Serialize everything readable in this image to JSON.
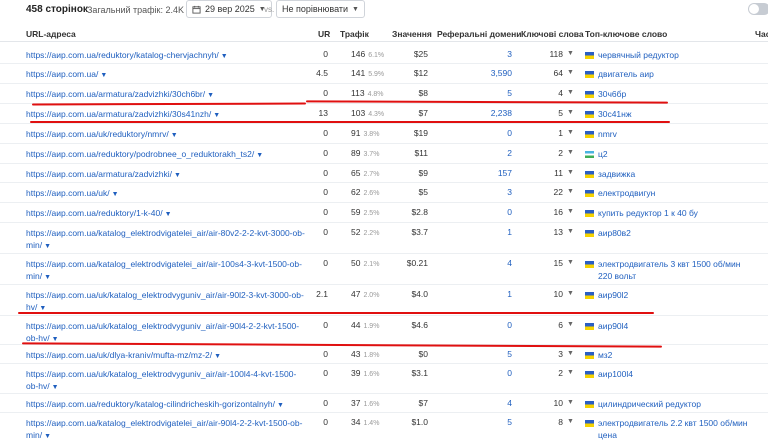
{
  "toolbar": {
    "pages_count": "458 сторінок",
    "total_traffic": "Загальний трафік: 2.4K",
    "date": "29 вер 2025",
    "vs": "vs.",
    "compare": "Не порівнювати"
  },
  "columns": {
    "url": "URL-адреса",
    "ur": "UR",
    "traffic": "Трафік",
    "value": "Значення",
    "ref_domains": "Реферальні домени",
    "keywords": "Ключові слова",
    "top_keyword": "Топ-ключове слово",
    "edge": "Част"
  },
  "rows": [
    {
      "url": "https://аир.com.ua/reduktory/katalog-chervjachnyh/",
      "ur": "0",
      "traffic": "146",
      "pct": "6.1%",
      "value": "$25",
      "ref": "3",
      "kw": "118",
      "flag": "ua",
      "top_kw": "червячный редуктор",
      "edge": ""
    },
    {
      "url": "https://аир.com.ua/",
      "ur": "4.5",
      "traffic": "141",
      "pct": "5.9%",
      "value": "$12",
      "ref": "3,590",
      "kw": "64",
      "flag": "ua",
      "top_kw": "двигатель аир",
      "edge": ""
    },
    {
      "url": "https://аир.com.ua/armatura/zadvizhki/30ch6br/",
      "ur": "0",
      "traffic": "113",
      "pct": "4.8%",
      "value": "$8",
      "ref": "5",
      "kw": "4",
      "flag": "ua",
      "top_kw": "30ч6бр",
      "edge": ""
    },
    {
      "url": "https://аир.com.ua/armatura/zadvizhki/30s41nzh/",
      "ur": "13",
      "traffic": "103",
      "pct": "4.3%",
      "value": "$7",
      "ref": "2,238",
      "kw": "5",
      "flag": "ua",
      "top_kw": "30с41нж",
      "edge": ""
    },
    {
      "url": "https://аир.com.ua/uk/reduktory/nmrv/",
      "ur": "0",
      "traffic": "91",
      "pct": "3.8%",
      "value": "$19",
      "ref": "0",
      "kw": "1",
      "flag": "ua",
      "top_kw": "nmrv",
      "edge": ""
    },
    {
      "url": "https://аир.com.ua/reduktory/podrobnee_o_reduktorakh_ts2/",
      "ur": "0",
      "traffic": "89",
      "pct": "3.7%",
      "value": "$11",
      "ref": "2",
      "kw": "2",
      "flag": "uz",
      "top_kw": "ц2",
      "edge": ""
    },
    {
      "url": "https://аир.com.ua/armatura/zadvizhki/",
      "ur": "0",
      "traffic": "65",
      "pct": "2.7%",
      "value": "$9",
      "ref": "157",
      "kw": "11",
      "flag": "ua",
      "top_kw": "задвижка",
      "edge": ""
    },
    {
      "url": "https://аир.com.ua/uk/",
      "ur": "0",
      "traffic": "62",
      "pct": "2.6%",
      "value": "$5",
      "ref": "3",
      "kw": "22",
      "flag": "ua",
      "top_kw": "електродвигун",
      "edge": ""
    },
    {
      "url": "https://аир.com.ua/reduktory/1-k-40/",
      "ur": "0",
      "traffic": "59",
      "pct": "2.5%",
      "value": "$2.8",
      "ref": "0",
      "kw": "16",
      "flag": "ua",
      "top_kw": "купить редуктор 1 к 40 бу",
      "edge": ""
    },
    {
      "url": "https://аир.com.ua/katalog_elektrodvigatelei_air/air-80v2-2-2-kvt-3000-ob-min/",
      "ur": "0",
      "traffic": "52",
      "pct": "2.2%",
      "value": "$3.7",
      "ref": "1",
      "kw": "13",
      "flag": "ua",
      "top_kw": "аир80в2",
      "edge": ""
    },
    {
      "url": "https://аир.com.ua/katalog_elektrodvigatelei_air/air-100s4-3-kvt-1500-ob-min/",
      "ur": "0",
      "traffic": "50",
      "pct": "2.1%",
      "value": "$0.21",
      "ref": "4",
      "kw": "15",
      "flag": "ua",
      "top_kw": "электродвигатель 3 квт 1500 об/мин 220 вольт",
      "edge": ""
    },
    {
      "url": "https://аир.com.ua/uk/katalog_elektrodvyguniv_air/air-90l2-3-kvt-3000-ob-hv/",
      "ur": "2.1",
      "traffic": "47",
      "pct": "2.0%",
      "value": "$4.0",
      "ref": "1",
      "kw": "10",
      "flag": "ua",
      "top_kw": "аир90l2",
      "edge": ""
    },
    {
      "url": "https://аир.com.ua/uk/katalog_elektrodvyguniv_air/air-90l4-2-2-kvt-1500-ob-hv/",
      "ur": "0",
      "traffic": "44",
      "pct": "1.9%",
      "value": "$4.6",
      "ref": "0",
      "kw": "6",
      "flag": "ua",
      "top_kw": "аир90l4",
      "edge": ""
    },
    {
      "url": "https://аир.com.ua/uk/dlya-kraniv/mufta-mz/mz-2/",
      "ur": "0",
      "traffic": "43",
      "pct": "1.8%",
      "value": "$0",
      "ref": "5",
      "kw": "3",
      "flag": "ua",
      "top_kw": "мз2",
      "edge": ""
    },
    {
      "url": "https://аир.com.ua/uk/katalog_elektrodvyguniv_air/air-100l4-4-kvt-1500-ob-hv/",
      "ur": "0",
      "traffic": "39",
      "pct": "1.6%",
      "value": "$3.1",
      "ref": "0",
      "kw": "2",
      "flag": "ua",
      "top_kw": "аир100l4",
      "edge": ""
    },
    {
      "url": "https://аир.com.ua/reduktory/katalog-cilindricheskih-gorizontalnyh/",
      "ur": "0",
      "traffic": "37",
      "pct": "1.6%",
      "value": "$7",
      "ref": "4",
      "kw": "10",
      "flag": "ua",
      "top_kw": "цилиндрический редуктор",
      "edge": ""
    },
    {
      "url": "https://аир.com.ua/katalog_elektrodvigatelei_air/air-90l4-2-2-kvt-1500-ob-min/",
      "ur": "0",
      "traffic": "34",
      "pct": "1.4%",
      "value": "$1.0",
      "ref": "5",
      "kw": "8",
      "flag": "ua",
      "top_kw": "электродвигатель 2.2 квт 1500 об/мин цена",
      "edge": ""
    }
  ]
}
